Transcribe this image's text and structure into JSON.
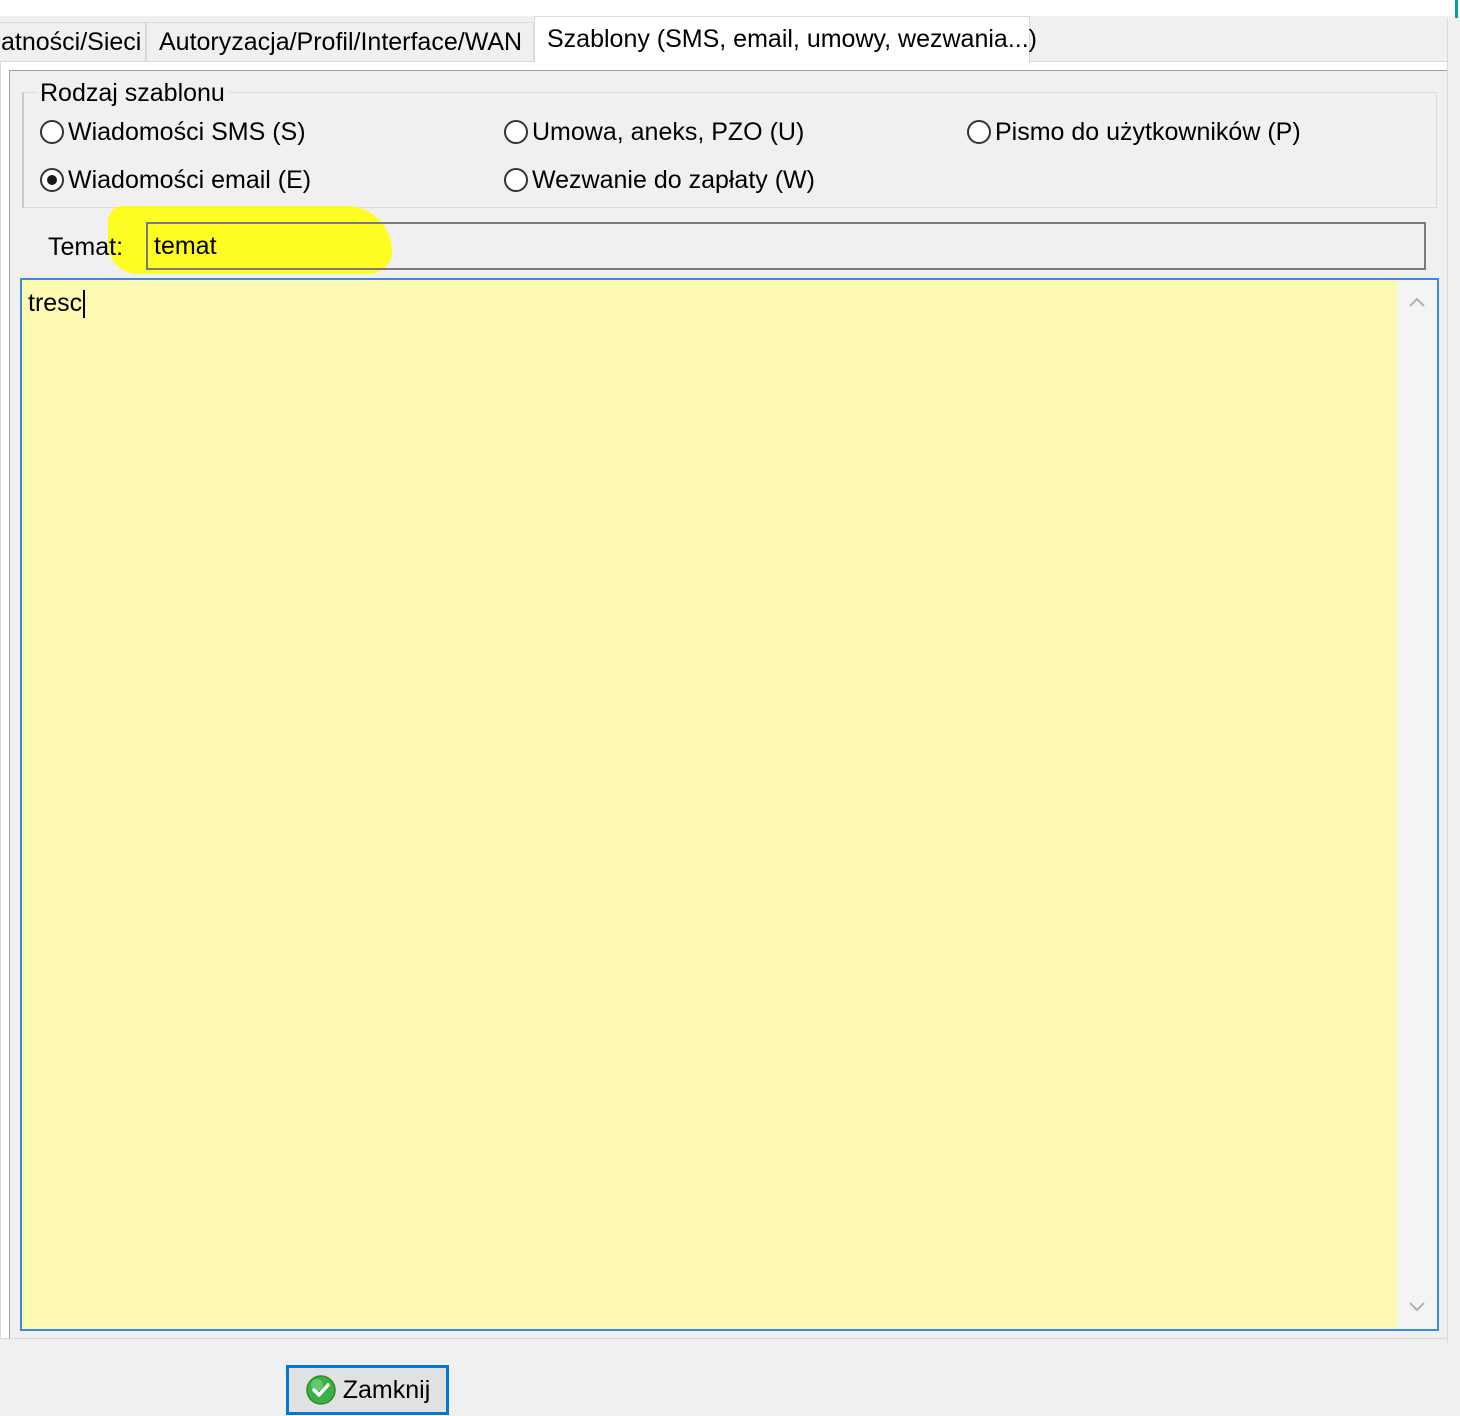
{
  "tabs": [
    {
      "label": "atności/Sieci"
    },
    {
      "label": "Autoryzacja/Profil/Interface/WAN"
    },
    {
      "label": "Szablony (SMS, email, umowy, wezwania...)",
      "active": true
    }
  ],
  "template_type": {
    "legend": "Rodzaj szablonu",
    "options": [
      {
        "label": "Wiadomości SMS (S)",
        "checked": false
      },
      {
        "label": "Umowa, aneks, PZO (U)",
        "checked": false
      },
      {
        "label": "Pismo do użytkowników (P)",
        "checked": false
      },
      {
        "label": "Wiadomości email (E)",
        "checked": true
      },
      {
        "label": "Wezwanie do zapłaty (W)",
        "checked": false
      }
    ]
  },
  "subject": {
    "label": "Temat:",
    "value": "temat"
  },
  "body": {
    "value": "tresc"
  },
  "buttons": {
    "close_label": "Zamknij"
  },
  "colors": {
    "body_background": "#fdf9b0",
    "highlight": "#ffff00",
    "focus_border": "#3c8ad8",
    "ok_icon": "#3cb043"
  },
  "icons": {
    "close_button_icon": "check-circle-icon",
    "scroll_up": "chevron-up-icon",
    "scroll_down": "chevron-down-icon"
  }
}
